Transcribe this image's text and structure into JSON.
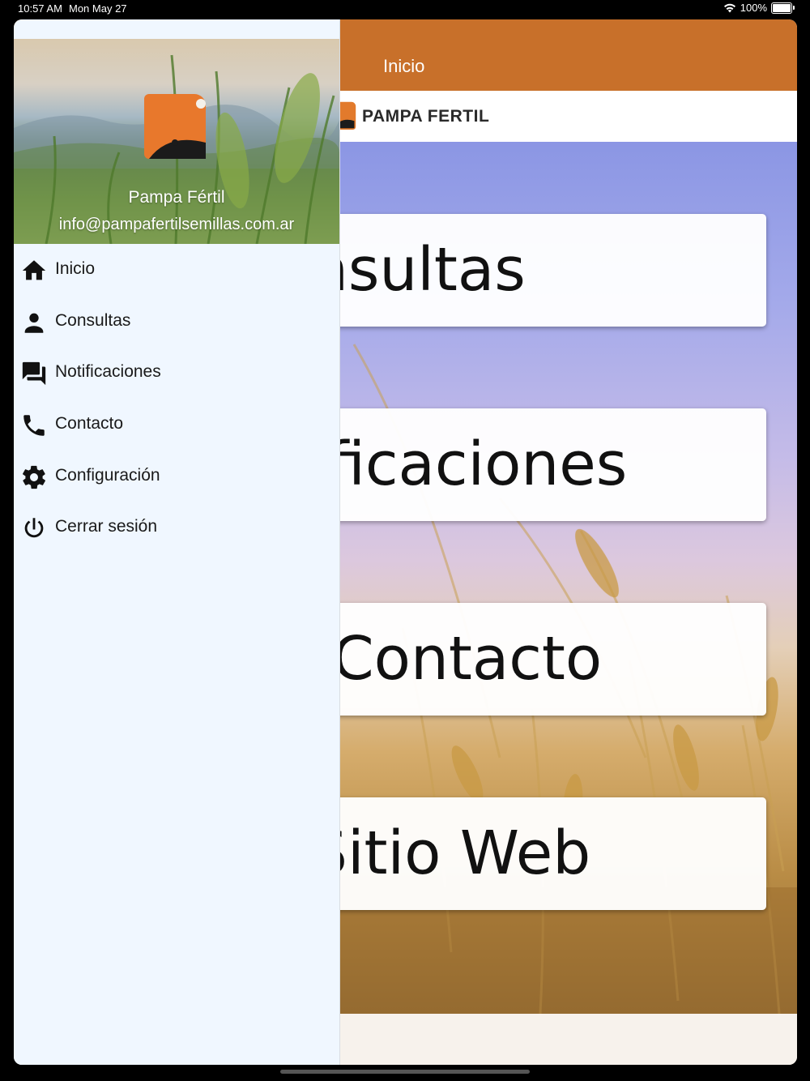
{
  "status_bar": {
    "time": "10:57 AM",
    "date": "Mon May 27",
    "battery": "100%"
  },
  "app_bar": {
    "title": "Inicio",
    "color": "#c8702a"
  },
  "brand": {
    "name": "PAMPA FERTIL"
  },
  "home_cards": [
    {
      "label": "Consultas"
    },
    {
      "label": "Notificaciones"
    },
    {
      "label": "Contacto"
    },
    {
      "label": "Sitio Web"
    }
  ],
  "drawer": {
    "profile_name": "Pampa Fértil",
    "profile_email": "info@pampafertilsemillas.com.ar",
    "items": [
      {
        "label": "Inicio",
        "icon": "home-icon"
      },
      {
        "label": "Consultas",
        "icon": "person-icon"
      },
      {
        "label": "Notificaciones",
        "icon": "forum-icon"
      },
      {
        "label": "Contacto",
        "icon": "phone-icon"
      },
      {
        "label": "Configuración",
        "icon": "gear-icon"
      },
      {
        "label": "Cerrar sesión",
        "icon": "power-icon"
      }
    ]
  }
}
